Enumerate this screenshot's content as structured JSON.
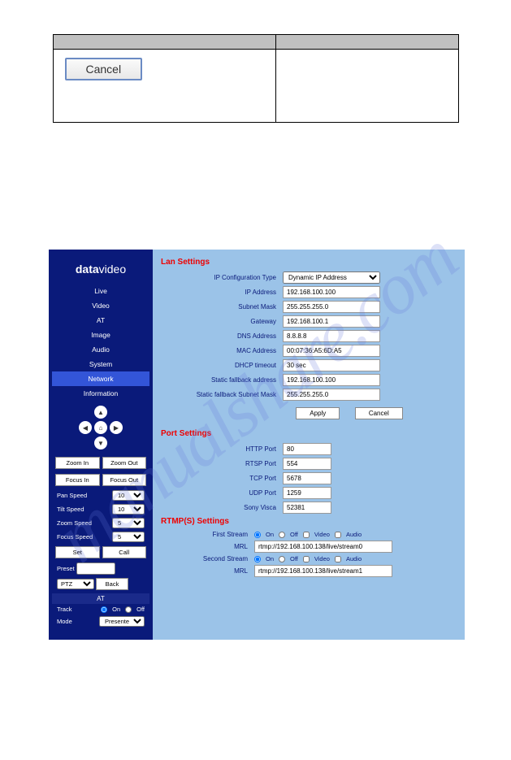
{
  "watermark": "manualshare.com",
  "doc_cancel": "Cancel",
  "logo_bold": "data",
  "logo_light": "video",
  "nav": [
    "Live",
    "Video",
    "AT",
    "Image",
    "Audio",
    "System",
    "Network",
    "Information"
  ],
  "nav_active": "Network",
  "ptz": {
    "up": "▲",
    "down": "▼",
    "left": "◀",
    "right": "▶",
    "home": "⌂"
  },
  "zoom_in": "Zoom In",
  "zoom_out": "Zoom Out",
  "focus_in": "Focus In",
  "focus_out": "Focus Out",
  "speeds": [
    {
      "label": "Pan Speed",
      "value": "10"
    },
    {
      "label": "Tilt Speed",
      "value": "10"
    },
    {
      "label": "Zoom Speed",
      "value": "5"
    },
    {
      "label": "Focus Speed",
      "value": "5"
    }
  ],
  "set_btn": "Set",
  "call_btn": "Call",
  "preset_label": "Preset",
  "ptz_select": "PTZ",
  "back_btn": "Back",
  "at_title": "AT",
  "track_label": "Track",
  "on_label": "On",
  "off_label": "Off",
  "mode_label": "Mode",
  "mode_value": "Presente",
  "lan": {
    "title": "Lan Settings",
    "fields": [
      {
        "label": "IP Configuration Type",
        "value": "Dynamic IP Address",
        "type": "select"
      },
      {
        "label": "IP Address",
        "value": "192.168.100.100"
      },
      {
        "label": "Subnet Mask",
        "value": "255.255.255.0"
      },
      {
        "label": "Gateway",
        "value": "192.168.100.1"
      },
      {
        "label": "DNS Address",
        "value": "8.8.8.8"
      },
      {
        "label": "MAC Address",
        "value": "00:07:36:A5:6D:A5"
      },
      {
        "label": "DHCP timeout",
        "value": "30 sec"
      },
      {
        "label": "Static fallback address",
        "value": "192.168.100.100"
      },
      {
        "label": "Static fallback Subnet Mask",
        "value": "255.255.255.0"
      }
    ],
    "apply": "Apply",
    "cancel": "Cancel"
  },
  "port": {
    "title": "Port Settings",
    "fields": [
      {
        "label": "HTTP Port",
        "value": "80"
      },
      {
        "label": "RTSP Port",
        "value": "554"
      },
      {
        "label": "TCP Port",
        "value": "5678"
      },
      {
        "label": "UDP Port",
        "value": "1259"
      },
      {
        "label": "Sony Visca",
        "value": "52381"
      }
    ]
  },
  "rtmp": {
    "title": "RTMP(S) Settings",
    "first_label": "First Stream",
    "second_label": "Second Stream",
    "mrl_label": "MRL",
    "video": "Video",
    "audio": "Audio",
    "mrl1": "rtmp://192.168.100.138/live/stream0",
    "mrl2": "rtmp://192.168.100.138/live/stream1"
  }
}
